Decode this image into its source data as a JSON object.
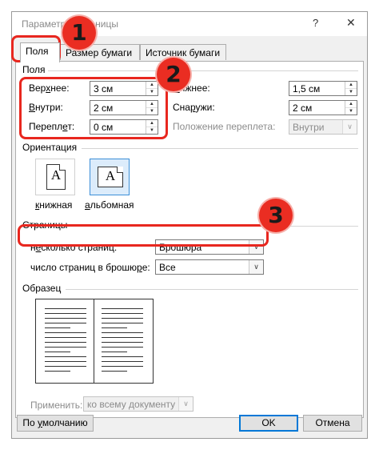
{
  "window": {
    "title": "Параметры страницы",
    "help_glyph": "?",
    "close_glyph": "✕"
  },
  "tabs": [
    {
      "label": "Поля",
      "active": true
    },
    {
      "label": "Размер бумаги",
      "active": false
    },
    {
      "label": "Источник бумаги",
      "active": false
    }
  ],
  "margins": {
    "group_label": "Поля",
    "top": {
      "label": "Верхнее:",
      "value": "3 см"
    },
    "bottom": {
      "label": "Нижнее:",
      "value": "1,5 см"
    },
    "inside": {
      "label": "Внутри:",
      "value": "2 см"
    },
    "outside": {
      "label": "Снаружи:",
      "value": "2 см"
    },
    "gutter": {
      "label": "Переплет:",
      "value": "0 см"
    },
    "gutter_position": {
      "label": "Положение переплета:",
      "value": "Внутри"
    }
  },
  "orientation": {
    "group_label": "Ориентация",
    "portrait_label": "книжная",
    "landscape_label": "альбомная",
    "glyph": "A",
    "selected": "landscape"
  },
  "pages": {
    "group_label": "Страницы",
    "multiple_pages": {
      "label": "несколько страниц:",
      "value": "Брошюра"
    },
    "sheets_per_booklet": {
      "label": "число страниц в брошюре:",
      "value": "Все"
    }
  },
  "preview": {
    "group_label": "Образец"
  },
  "apply_to": {
    "label": "Применить:",
    "value": "ко всему документу"
  },
  "buttons": {
    "default": "По умолчанию",
    "ok": "OK",
    "cancel": "Отмена"
  },
  "annotations": {
    "step1": "1",
    "step2": "2",
    "step3": "3",
    "color": "#e8271f"
  },
  "icons": {
    "spin_up": "▲",
    "spin_down": "▼",
    "dropdown": "∨"
  }
}
